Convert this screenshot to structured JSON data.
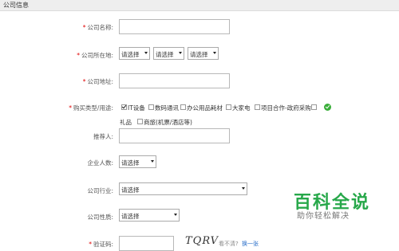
{
  "section_title": "公司信息",
  "labels": {
    "company_name": "公司名称:",
    "company_location": "公司所在地:",
    "company_address": "公司地址:",
    "purchase_type": "购买类型/用途:",
    "referrer": "推荐人:",
    "employee_count": "企业人数:",
    "industry": "公司行业:",
    "company_nature": "公司性质:",
    "verify_code": "验证码:"
  },
  "required_mark": "*",
  "inputs": {
    "company_name": "",
    "company_address": "",
    "referrer": "",
    "verify_code": ""
  },
  "selects": {
    "province": "请选择",
    "city": "请选择",
    "district": "请选择",
    "employee_count": "请选择",
    "industry": "请选择",
    "company_nature": "请选择"
  },
  "purchase_options": [
    {
      "label": "IT设备",
      "checked": true
    },
    {
      "label": "数码通讯",
      "checked": false
    },
    {
      "label": "办公用品耗材",
      "checked": false
    },
    {
      "label": "大家电",
      "checked": false
    },
    {
      "label": "项目合作-政府采购",
      "checked": false
    },
    {
      "label": "礼品",
      "checked": false
    },
    {
      "label": "商旅(机票/酒店等)",
      "checked": false
    }
  ],
  "captcha": {
    "text": "TQRV",
    "unclear": "看不清?",
    "change": "换一张"
  },
  "watermark": {
    "title": "百科全说",
    "subtitle": "助你轻松解决"
  },
  "colors": {
    "required": "#e00000",
    "valid": "#3aae3a",
    "watermark": "#27a84a",
    "link": "#2a6fc9"
  }
}
